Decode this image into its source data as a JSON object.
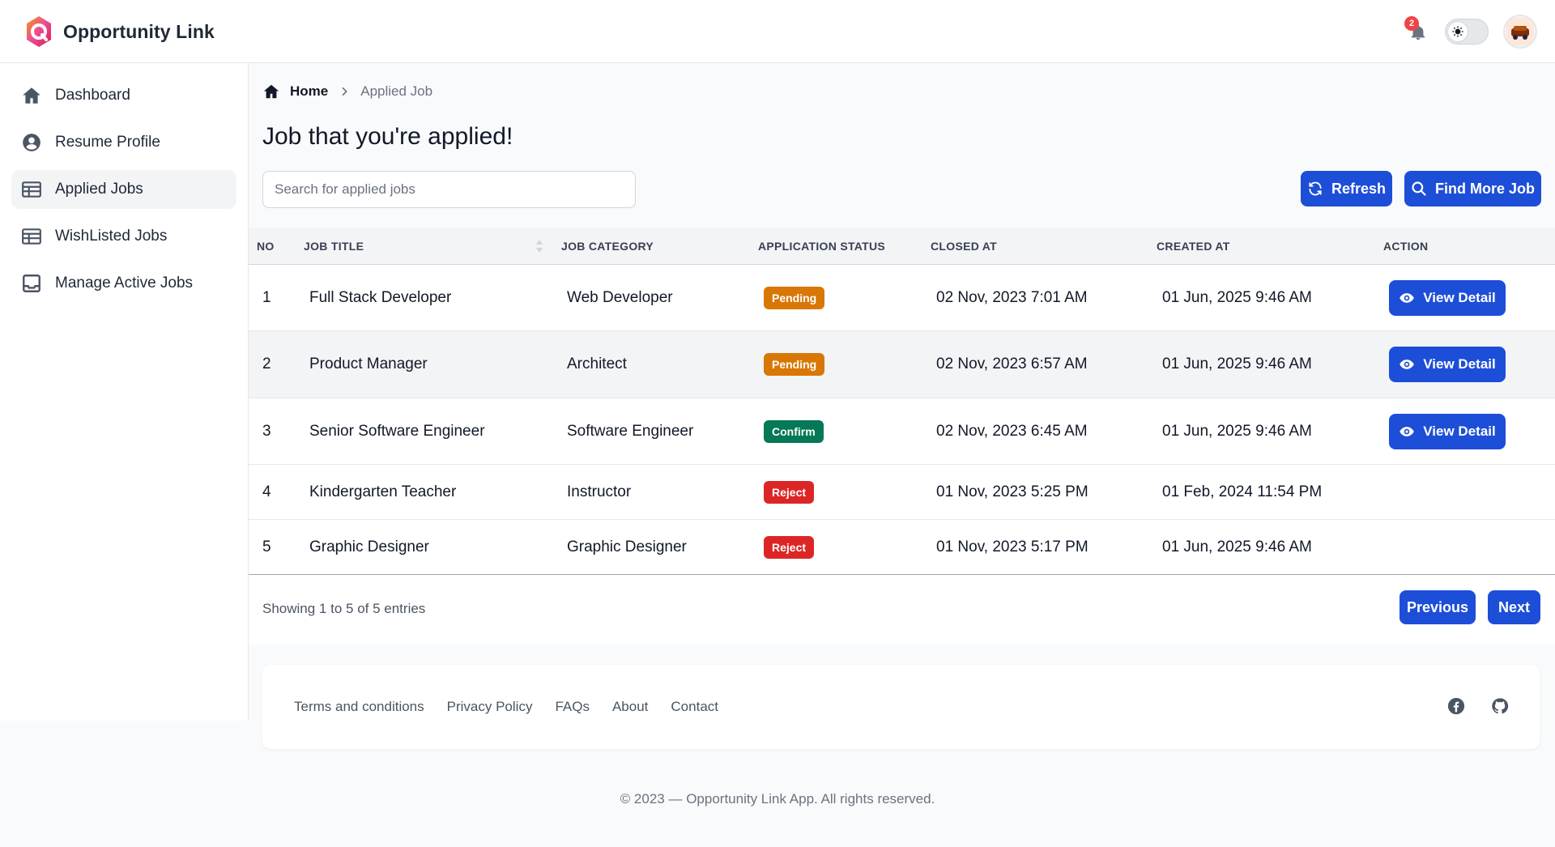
{
  "app": {
    "name": "Opportunity Link",
    "notifications_count": "2"
  },
  "sidebar": {
    "items": [
      {
        "label": "Dashboard",
        "icon": "home-icon",
        "active": false
      },
      {
        "label": "Resume Profile",
        "icon": "user-circle-icon",
        "active": false
      },
      {
        "label": "Applied Jobs",
        "icon": "table-icon",
        "active": true
      },
      {
        "label": "WishListed Jobs",
        "icon": "table-icon",
        "active": false
      },
      {
        "label": "Manage Active Jobs",
        "icon": "inbox-icon",
        "active": false
      }
    ]
  },
  "breadcrumb": {
    "home": "Home",
    "current": "Applied Job"
  },
  "page": {
    "title": "Job that you're applied!"
  },
  "search": {
    "placeholder": "Search for applied jobs",
    "value": ""
  },
  "actions": {
    "refresh": "Refresh",
    "find_more": "Find More Job"
  },
  "table": {
    "columns": [
      "NO",
      "JOB TITLE",
      "JOB CATEGORY",
      "APPLICATION STATUS",
      "CLOSED AT",
      "CREATED AT",
      "ACTION"
    ],
    "rows": [
      {
        "no": "1",
        "title": "Full Stack Developer",
        "category": "Web Developer",
        "status": "Pending",
        "closed": "02 Nov, 2023 7:01 AM",
        "created": "01 Jun, 2025 9:46 AM",
        "action": "View Detail"
      },
      {
        "no": "2",
        "title": "Product Manager",
        "category": "Architect",
        "status": "Pending",
        "closed": "02 Nov, 2023 6:57 AM",
        "created": "01 Jun, 2025 9:46 AM",
        "action": "View Detail"
      },
      {
        "no": "3",
        "title": "Senior Software Engineer",
        "category": "Software Engineer",
        "status": "Confirm",
        "closed": "02 Nov, 2023 6:45 AM",
        "created": "01 Jun, 2025 9:46 AM",
        "action": "View Detail"
      },
      {
        "no": "4",
        "title": "Kindergarten Teacher",
        "category": "Instructor",
        "status": "Reject",
        "closed": "01 Nov, 2023 5:25 PM",
        "created": "01 Feb, 2024 11:54 PM",
        "action": ""
      },
      {
        "no": "5",
        "title": "Graphic Designer",
        "category": "Graphic Designer",
        "status": "Reject",
        "closed": "01 Nov, 2023 5:17 PM",
        "created": "01 Jun, 2025 9:46 AM",
        "action": ""
      }
    ]
  },
  "pagination": {
    "summary": "Showing 1 to 5 of 5 entries",
    "previous": "Previous",
    "next": "Next"
  },
  "footer": {
    "links": [
      "Terms and conditions",
      "Privacy Policy",
      "FAQs",
      "About",
      "Contact"
    ],
    "social": [
      "facebook-icon",
      "github-icon"
    ],
    "copyright": "© 2023 — Opportunity Link App. All rights reserved."
  },
  "colors": {
    "primary": "#1d4ed8",
    "pending": "#d97706",
    "confirm": "#047857",
    "reject": "#dc2626",
    "badge_notification": "#ef4444"
  }
}
